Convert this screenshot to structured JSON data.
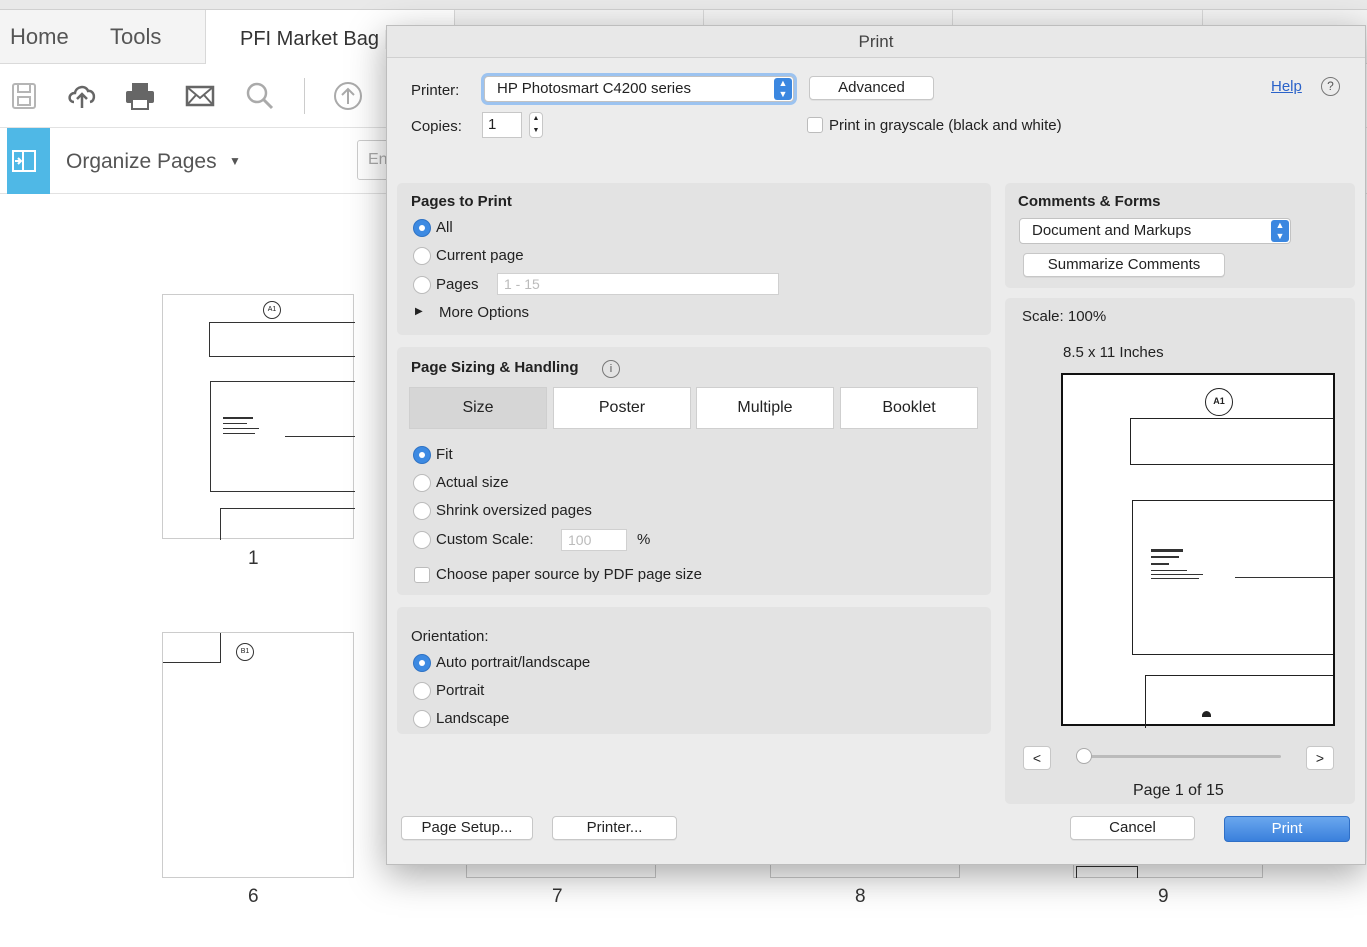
{
  "app": {
    "tabs": [
      {
        "label": "Home"
      },
      {
        "label": "Tools"
      }
    ],
    "document_tab": "PFI Market Bag [",
    "organize_label": "Organize Pages",
    "organize_input_placeholder": "En",
    "thumbnails": [
      {
        "label": "1",
        "badge": "A1"
      },
      {
        "label": "6",
        "badge": "B1"
      },
      {
        "label": "7"
      },
      {
        "label": "8"
      },
      {
        "label": "9"
      }
    ]
  },
  "dialog": {
    "title": "Print",
    "printer_label": "Printer:",
    "printer_value": "HP Photosmart C4200 series",
    "advanced_label": "Advanced",
    "help_label": "Help",
    "copies_label": "Copies:",
    "copies_value": "1",
    "grayscale_label": "Print in grayscale (black and white)",
    "pages_to_print": {
      "heading": "Pages to Print",
      "all": "All",
      "current": "Current page",
      "pages": "Pages",
      "pages_placeholder": "1 - 15",
      "more_options": "More Options"
    },
    "sizing": {
      "heading": "Page Sizing & Handling",
      "tabs": [
        "Size",
        "Poster",
        "Multiple",
        "Booklet"
      ],
      "fit": "Fit",
      "actual": "Actual size",
      "shrink": "Shrink oversized pages",
      "custom": "Custom Scale:",
      "custom_value": "100",
      "percent": "%",
      "paper_source": "Choose paper source by PDF page size"
    },
    "orientation": {
      "heading": "Orientation:",
      "auto": "Auto portrait/landscape",
      "portrait": "Portrait",
      "landscape": "Landscape"
    },
    "comments": {
      "heading": "Comments & Forms",
      "value": "Document and Markups",
      "summarize": "Summarize Comments"
    },
    "preview": {
      "scale": "Scale: 100%",
      "paper_size": "8.5 x 11 Inches",
      "badge": "A1",
      "prev": "<",
      "next": ">",
      "page_counter": "Page 1 of 15"
    },
    "buttons": {
      "page_setup": "Page Setup...",
      "printer": "Printer...",
      "cancel": "Cancel",
      "print": "Print"
    }
  }
}
